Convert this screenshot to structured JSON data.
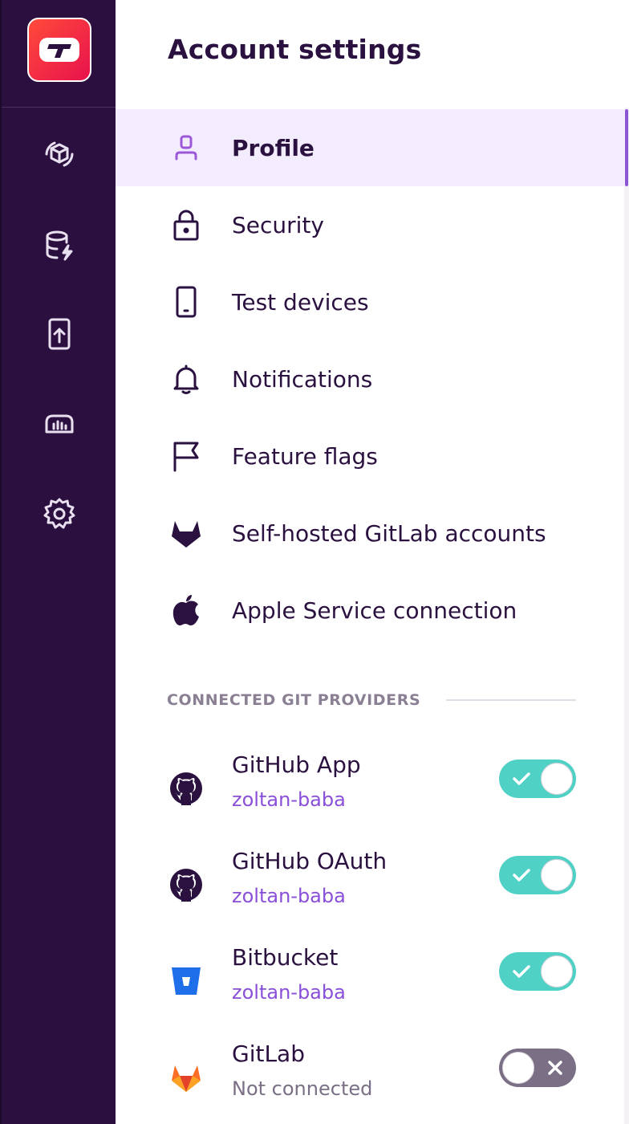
{
  "sidebar": {
    "logo_name": "app-logo",
    "icons": [
      "apps-icon",
      "database-bolt-icon",
      "device-upload-icon",
      "dashboard-icon",
      "gear-icon"
    ]
  },
  "header": {
    "title": "Account settings"
  },
  "nav": {
    "items": [
      {
        "label": "Profile",
        "icon": "person-icon",
        "active": true
      },
      {
        "label": "Security",
        "icon": "lock-icon"
      },
      {
        "label": "Test devices",
        "icon": "phone-icon"
      },
      {
        "label": "Notifications",
        "icon": "bell-icon"
      },
      {
        "label": "Feature flags",
        "icon": "flag-icon"
      },
      {
        "label": "Self-hosted GitLab accounts",
        "icon": "gitlab-icon"
      },
      {
        "label": "Apple Service connection",
        "icon": "apple-icon"
      }
    ]
  },
  "git": {
    "section_label": "CONNECTED GIT PROVIDERS",
    "providers": [
      {
        "name": "GitHub App",
        "user": "zoltan-baba",
        "icon": "github-icon",
        "connected": true
      },
      {
        "name": "GitHub OAuth",
        "user": "zoltan-baba",
        "icon": "github-icon",
        "connected": true
      },
      {
        "name": "Bitbucket",
        "user": "zoltan-baba",
        "icon": "bitbucket-icon",
        "connected": true
      },
      {
        "name": "GitLab",
        "user": "Not connected",
        "icon": "gitlab-color-icon",
        "connected": false
      }
    ]
  },
  "colors": {
    "sidebar_bg": "#2b0f3f",
    "accent": "#8a4fd8",
    "toggle_on": "#4fd1c5",
    "toggle_off": "#7a6f84",
    "active_row": "#f3ecfc"
  }
}
